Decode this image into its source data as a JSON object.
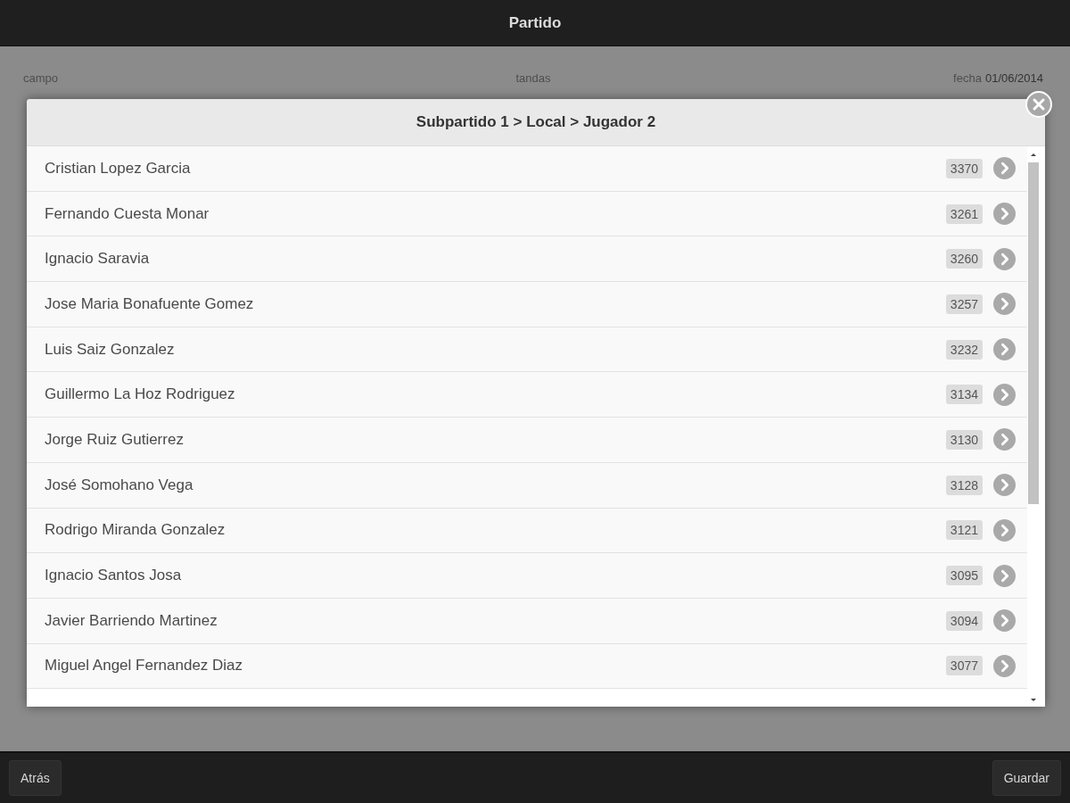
{
  "app_bar": {
    "title": "Partido"
  },
  "match_info": {
    "fields": [
      {
        "label": "campo"
      },
      {
        "label": "tandas"
      },
      {
        "label": "fecha",
        "value": "01/06/2014"
      }
    ]
  },
  "dialog": {
    "title": "Subpartido 1 > Local > Jugador 2",
    "players": [
      {
        "name": "Cristian Lopez Garcia",
        "number": "3370"
      },
      {
        "name": "Fernando Cuesta Monar",
        "number": "3261"
      },
      {
        "name": "Ignacio Saravia",
        "number": "3260"
      },
      {
        "name": "Jose Maria Bonafuente Gomez",
        "number": "3257"
      },
      {
        "name": "Luis Saiz Gonzalez",
        "number": "3232"
      },
      {
        "name": "Guillermo La Hoz Rodriguez",
        "number": "3134"
      },
      {
        "name": "Jorge Ruiz Gutierrez",
        "number": "3130"
      },
      {
        "name": "José Somohano Vega",
        "number": "3128"
      },
      {
        "name": "Rodrigo Miranda Gonzalez",
        "number": "3121"
      },
      {
        "name": "Ignacio Santos Josa",
        "number": "3095"
      },
      {
        "name": "Javier Barriendo Martinez",
        "number": "3094"
      },
      {
        "name": "Miguel Angel Fernandez Diaz",
        "number": "3077"
      }
    ]
  },
  "footer": {
    "back_button": "Atrás",
    "save_button": "Guardar"
  }
}
